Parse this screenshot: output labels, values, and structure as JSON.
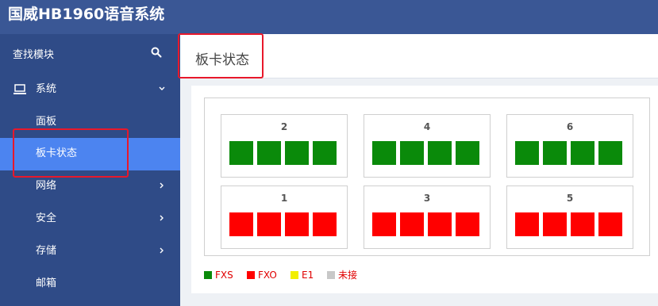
{
  "app": {
    "title": "国威HB1960语音系统"
  },
  "sidebar": {
    "search_label": "查找模块",
    "search_icon": "search-icon",
    "items": [
      {
        "label": "系统",
        "icon": "laptop-icon",
        "expanded": true
      },
      {
        "label": "面板"
      },
      {
        "label": "板卡状态",
        "active": true
      },
      {
        "label": "网络",
        "has_submenu": true
      },
      {
        "label": "安全",
        "has_submenu": true
      },
      {
        "label": "存储",
        "has_submenu": true
      },
      {
        "label": "邮箱"
      }
    ]
  },
  "page": {
    "title": "板卡状态"
  },
  "slots": [
    {
      "number": "2",
      "ports": [
        "FXS",
        "FXS",
        "FXS",
        "FXS"
      ]
    },
    {
      "number": "4",
      "ports": [
        "FXS",
        "FXS",
        "FXS",
        "FXS"
      ]
    },
    {
      "number": "6",
      "ports": [
        "FXS",
        "FXS",
        "FXS",
        "FXS"
      ]
    },
    {
      "number": "1",
      "ports": [
        "FXO",
        "FXO",
        "FXO",
        "FXO"
      ]
    },
    {
      "number": "3",
      "ports": [
        "FXO",
        "FXO",
        "FXO",
        "FXO"
      ]
    },
    {
      "number": "5",
      "ports": [
        "FXO",
        "FXO",
        "FXO",
        "FXO"
      ]
    }
  ],
  "legend": [
    {
      "label": "FXS",
      "color": "#0a8a0a"
    },
    {
      "label": "FXO",
      "color": "#ff0000"
    },
    {
      "label": "E1",
      "color": "#f2ef00"
    },
    {
      "label": "未接",
      "color": "#c8c8c8"
    }
  ],
  "colors": {
    "topbar": "#3a5795",
    "sidebar": "#2f4b87",
    "active_item": "#4c84f0",
    "highlight_border": "#e8182b",
    "legend_text": "#e00000"
  }
}
